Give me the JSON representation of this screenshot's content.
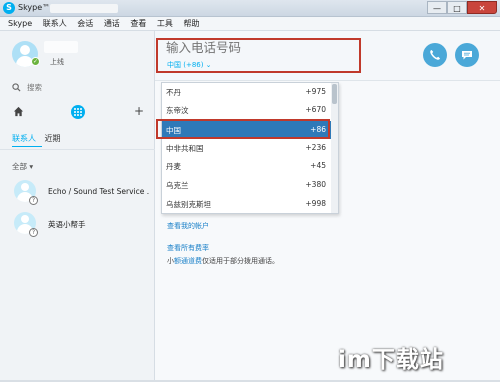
{
  "window": {
    "app_name": "Skype™",
    "title_sep": " - ",
    "min": "—",
    "max": "□",
    "close": "✕"
  },
  "menu": [
    "Skype",
    "联系人",
    "会话",
    "通话",
    "查看",
    "工具",
    "帮助"
  ],
  "profile": {
    "status": "上线"
  },
  "search": {
    "placeholder": "搜索"
  },
  "nav": {
    "plus": "+"
  },
  "tabs": {
    "contacts": "联系人",
    "recent": "近期"
  },
  "group": {
    "label": "全部 ▾"
  },
  "contacts": [
    {
      "name": "Echo / Sound Test Service ."
    },
    {
      "name": "英语小帮手"
    }
  ],
  "dialer": {
    "placeholder": "输入电话号码",
    "country": "中国 (+86) ⌄"
  },
  "countries": [
    {
      "name": "不丹",
      "code": "+975",
      "selected": false
    },
    {
      "name": "东帝汶",
      "code": "+670",
      "selected": false
    },
    {
      "name": "中国",
      "code": "+86",
      "selected": true
    },
    {
      "name": "中非共和国",
      "code": "+236",
      "selected": false
    },
    {
      "name": "丹麦",
      "code": "+45",
      "selected": false
    },
    {
      "name": "乌克兰",
      "code": "+380",
      "selected": false
    },
    {
      "name": "乌兹别克斯坦",
      "code": "+998",
      "selected": false
    }
  ],
  "links": {
    "account": "查看我的帐户",
    "rates": "查看所有费率",
    "note_prefix": "小",
    "note_link": "额通道费",
    "note_suffix": "仅适用于部分拨用通话。"
  },
  "watermark": "im下载站",
  "colors": {
    "accent": "#00aff0",
    "selected": "#2e79b8",
    "highlight_box": "#c0392b"
  }
}
